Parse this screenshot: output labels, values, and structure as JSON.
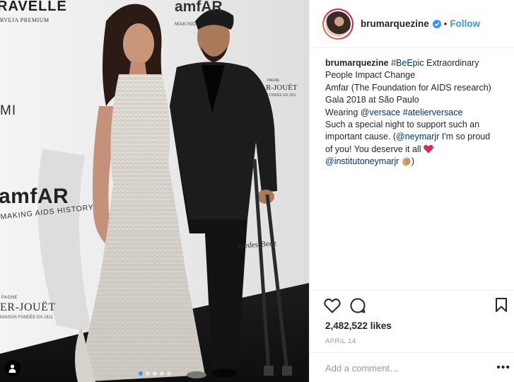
{
  "photo": {
    "backdrop_texts": {
      "bravelle": "RAVELLE",
      "bravelle_sub": "RVEJA PREMIUM",
      "amfar_top": "amfAR",
      "amfar_top_sub": "MAKING",
      "mi": "MI",
      "amfar_big": "amfAR",
      "amfar_big_sub": "MAKING AIDS HISTORY",
      "perrier_small_left": "PAGNE",
      "perrier_left": "ER-JOUËT",
      "perrier_left_sub": "MAISON FONDÉE EN 1811",
      "perrier_small_right": "PAGNE",
      "perrier_right": "R-JOUËT",
      "perrier_right_sub": "FONDÉE EN 1811",
      "mercedes": "rcedes-Benz"
    },
    "carousel": {
      "count": 5,
      "active_index": 0
    },
    "colors": {
      "accent": "#3897f0"
    },
    "icons": {
      "tag": "user-tag-icon"
    }
  },
  "header": {
    "username": "brumarquezine",
    "verified_icon": "verified-badge-icon",
    "separator": "•",
    "follow_label": "Follow"
  },
  "caption": {
    "username": "brumarquezine",
    "lines": {
      "l1_tag": "#BeEpic",
      "l1_text": " Extraordinary",
      "l2": "People Impact Change",
      "l3": "Amfar (The Foundation for AIDS research)",
      "l4": "Gala 2018 at São Paulo",
      "l5_text": "Wearing ",
      "l5_mention": "@versace",
      "l5_space": " ",
      "l5_tag": "#atelierversace",
      "l6": "Such a special night to support such an",
      "l7_text": "important cause. (",
      "l7_mention": "@neymarjr",
      "l7_rest": " I'm so proud",
      "l8": "of you! You deserve it all ",
      "l9_mention": "@institutoneymarjr",
      "l9_close": ")"
    },
    "emoji": {
      "heart": "red-heart-icon",
      "clap": "clapping-hands-icon"
    }
  },
  "actions": {
    "icons": [
      "heart-outline-icon",
      "comment-bubble-icon",
      "bookmark-icon"
    ],
    "likes": "2,482,522 likes",
    "date": "APRIL 14"
  },
  "comment": {
    "placeholder": "Add a comment…",
    "more": "•••"
  }
}
